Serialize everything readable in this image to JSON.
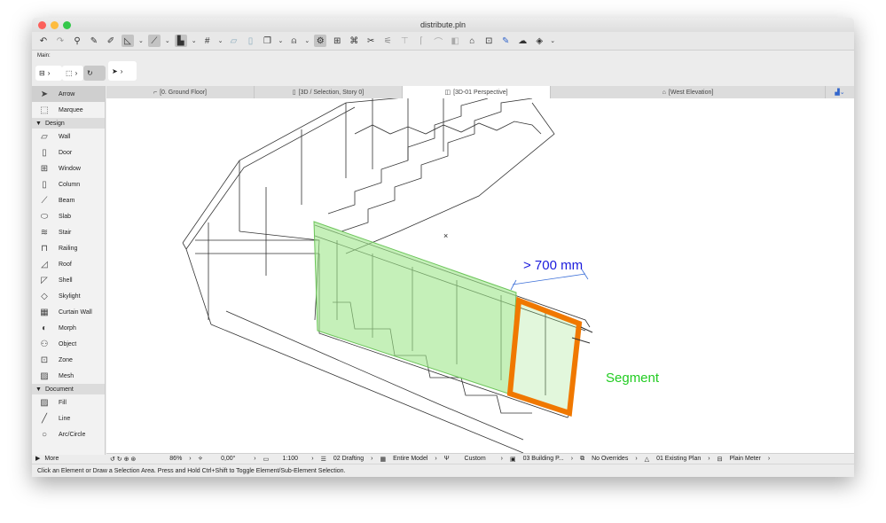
{
  "window": {
    "title": "distribute.pln"
  },
  "infobox": {
    "label": "Main:"
  },
  "tabs": [
    {
      "label": "[0. Ground Floor]"
    },
    {
      "label": "[3D / Selection, Story 0]"
    },
    {
      "label": "[3D-01 Perspective]"
    },
    {
      "label": "[West Elevation]"
    }
  ],
  "sidebar": {
    "top": [
      {
        "label": "Arrow"
      },
      {
        "label": "Marquee"
      }
    ],
    "design_header": "Design",
    "design": [
      {
        "label": "Wall"
      },
      {
        "label": "Door"
      },
      {
        "label": "Window"
      },
      {
        "label": "Column"
      },
      {
        "label": "Beam"
      },
      {
        "label": "Slab"
      },
      {
        "label": "Stair"
      },
      {
        "label": "Railing"
      },
      {
        "label": "Roof"
      },
      {
        "label": "Shell"
      },
      {
        "label": "Skylight"
      },
      {
        "label": "Curtain Wall"
      },
      {
        "label": "Morph"
      },
      {
        "label": "Object"
      },
      {
        "label": "Zone"
      },
      {
        "label": "Mesh"
      }
    ],
    "document_header": "Document",
    "document": [
      {
        "label": "Fill"
      },
      {
        "label": "Line"
      },
      {
        "label": "Arc/Circle"
      }
    ],
    "more": "More"
  },
  "viewport": {
    "dimension_label": "> 700 mm",
    "segment_label": "Segment",
    "colors": {
      "highlight": "#9ee68a",
      "segment": "#f07800",
      "dimension": "#1a1adc",
      "segment_text": "#22cc22"
    }
  },
  "status": {
    "zoom": "86%",
    "angle": "0,00°",
    "scale": "1:100",
    "layer": "02 Drafting",
    "model": "Entire Model",
    "pen": "Custom",
    "building": "03 Building P...",
    "overrides": "No Overrides",
    "plan": "01 Existing Plan",
    "dimension": "Plain Meter"
  },
  "message": "Click an Element or Draw a Selection Area. Press and Hold Ctrl+Shift to Toggle Element/Sub-Element Selection."
}
